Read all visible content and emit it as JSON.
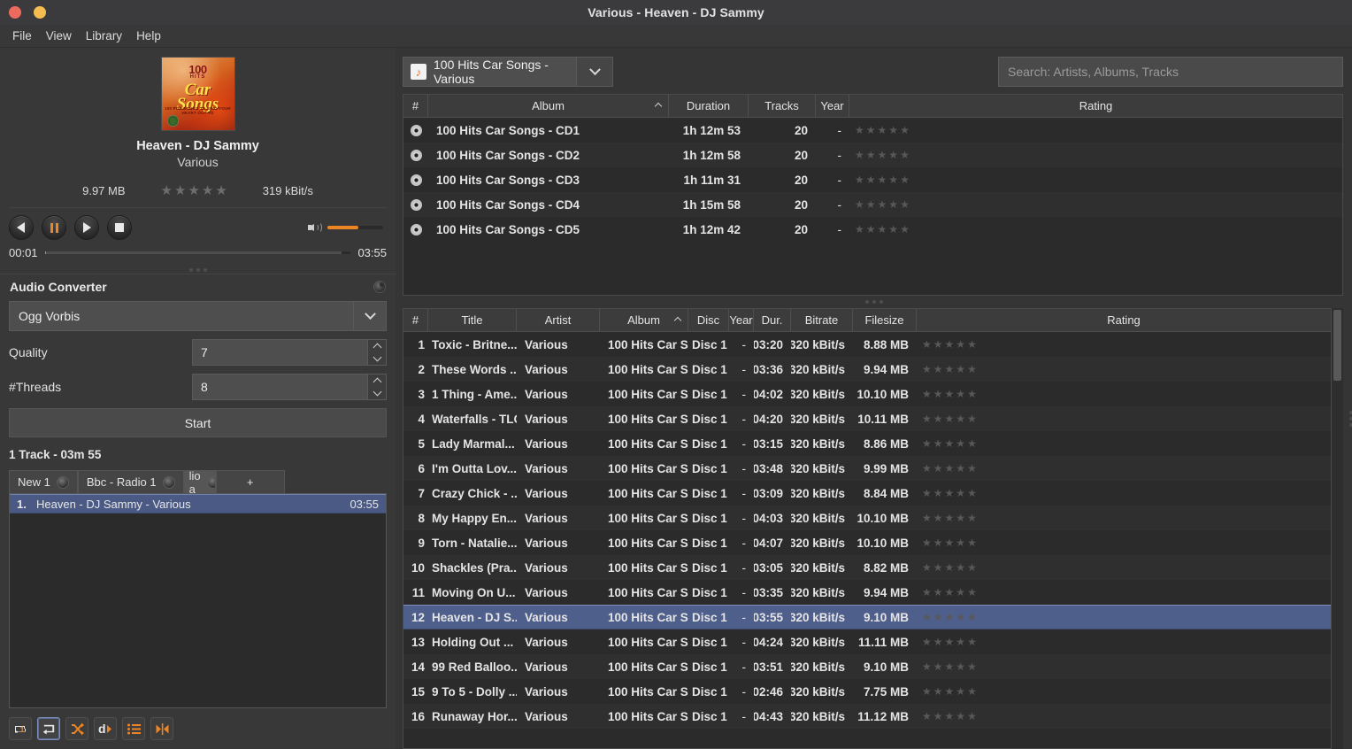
{
  "window": {
    "title": "Various - Heaven - DJ Sammy",
    "buttons": {
      "close": "close",
      "minimize": "minimize"
    }
  },
  "menu": {
    "items": [
      "File",
      "View",
      "Library",
      "Help"
    ]
  },
  "now_playing": {
    "title": "Heaven - DJ Sammy",
    "artist": "Various",
    "filesize": "9.97 MB",
    "bitrate": "319 kBit/s",
    "rating": 0,
    "rating_max": 5,
    "elapsed": "00:01",
    "total": "03:55",
    "progress_percent": 0.45,
    "buffer_percent": 97,
    "volume_percent": 55,
    "cover": {
      "line1": "100",
      "line2": "HITS",
      "line3": "Car",
      "line4": "Songs",
      "tagline": "100 POP SONGS TO SING YOUR HEART OUT TO"
    },
    "controls": {
      "previous": "previous-track",
      "pause": "pause",
      "next": "next-track",
      "stop": "stop"
    }
  },
  "converter": {
    "title": "Audio Converter",
    "format": "Ogg Vorbis",
    "quality_label": "Quality",
    "quality_value": "7",
    "threads_label": "#Threads",
    "threads_value": "8",
    "start_label": "Start",
    "status": "1 Track - 03m 55"
  },
  "playlist": {
    "tabs": [
      {
        "label": "New 1",
        "active": false,
        "partial": false
      },
      {
        "label": "Bbc - Radio 1",
        "active": false,
        "partial": false
      },
      {
        "label": "lio a",
        "active": true,
        "partial": true
      }
    ],
    "add_tab_label": "+",
    "rows": [
      {
        "index": "1.",
        "name": "Heaven - DJ Sammy - Various",
        "duration": "03:55",
        "selected": true
      }
    ],
    "toolbar": [
      {
        "name": "repeat-one-icon",
        "active": false
      },
      {
        "name": "repeat-all-icon",
        "active": true
      },
      {
        "name": "shuffle-icon",
        "active": false
      },
      {
        "name": "dynamic-playlist-icon",
        "active": false
      },
      {
        "name": "queue-list-icon",
        "active": false
      },
      {
        "name": "jump-to-playing-icon",
        "active": false
      }
    ]
  },
  "library": {
    "album_selector": "100 Hits Car Songs - Various",
    "search_placeholder": "Search: Artists, Albums, Tracks",
    "search_value": "",
    "album_table": {
      "columns": [
        "#",
        "Album",
        "Duration",
        "Tracks",
        "Year",
        "Rating"
      ],
      "sorted_column": "Album",
      "sort_direction": "asc",
      "rows": [
        {
          "num": "",
          "album": "100 Hits Car Songs - CD1",
          "duration": "1h 12m 53",
          "tracks": "20",
          "year": "-",
          "rating": 0
        },
        {
          "num": "",
          "album": "100 Hits Car Songs - CD2",
          "duration": "1h 12m 58",
          "tracks": "20",
          "year": "-",
          "rating": 0
        },
        {
          "num": "",
          "album": "100 Hits Car Songs - CD3",
          "duration": "1h 11m 31",
          "tracks": "20",
          "year": "-",
          "rating": 0
        },
        {
          "num": "",
          "album": "100 Hits Car Songs - CD4",
          "duration": "1h 15m 58",
          "tracks": "20",
          "year": "-",
          "rating": 0
        },
        {
          "num": "",
          "album": "100 Hits Car Songs - CD5",
          "duration": "1h 12m 42",
          "tracks": "20",
          "year": "-",
          "rating": 0
        }
      ]
    },
    "track_table": {
      "columns": [
        "#",
        "Title",
        "Artist",
        "Album",
        "Disc",
        "Year",
        "Dur.",
        "Bitrate",
        "Filesize",
        "Rating"
      ],
      "sorted_column": "Album",
      "sort_direction": "asc",
      "rows": [
        {
          "num": "1",
          "title": "Toxic - Britne...",
          "artist": "Various",
          "album": "100 Hits Car S...",
          "disc": "Disc 1",
          "year": "-",
          "dur": "03:20",
          "bitrate": "320 kBit/s",
          "filesize": "8.88 MB",
          "rating": 0,
          "selected": false
        },
        {
          "num": "2",
          "title": "These Words ...",
          "artist": "Various",
          "album": "100 Hits Car S...",
          "disc": "Disc 1",
          "year": "-",
          "dur": "03:36",
          "bitrate": "320 kBit/s",
          "filesize": "9.94 MB",
          "rating": 0,
          "selected": false
        },
        {
          "num": "3",
          "title": "1 Thing - Ame...",
          "artist": "Various",
          "album": "100 Hits Car S...",
          "disc": "Disc 1",
          "year": "-",
          "dur": "04:02",
          "bitrate": "320 kBit/s",
          "filesize": "10.10 MB",
          "rating": 0,
          "selected": false
        },
        {
          "num": "4",
          "title": "Waterfalls - TLC",
          "artist": "Various",
          "album": "100 Hits Car S...",
          "disc": "Disc 1",
          "year": "-",
          "dur": "04:20",
          "bitrate": "320 kBit/s",
          "filesize": "10.11 MB",
          "rating": 0,
          "selected": false
        },
        {
          "num": "5",
          "title": "Lady Marmal...",
          "artist": "Various",
          "album": "100 Hits Car S...",
          "disc": "Disc 1",
          "year": "-",
          "dur": "03:15",
          "bitrate": "320 kBit/s",
          "filesize": "8.86 MB",
          "rating": 0,
          "selected": false
        },
        {
          "num": "6",
          "title": "I'm Outta Lov...",
          "artist": "Various",
          "album": "100 Hits Car S...",
          "disc": "Disc 1",
          "year": "-",
          "dur": "03:48",
          "bitrate": "320 kBit/s",
          "filesize": "9.99 MB",
          "rating": 0,
          "selected": false
        },
        {
          "num": "7",
          "title": "Crazy Chick - ...",
          "artist": "Various",
          "album": "100 Hits Car S...",
          "disc": "Disc 1",
          "year": "-",
          "dur": "03:09",
          "bitrate": "320 kBit/s",
          "filesize": "8.84 MB",
          "rating": 0,
          "selected": false
        },
        {
          "num": "8",
          "title": "My Happy En...",
          "artist": "Various",
          "album": "100 Hits Car S...",
          "disc": "Disc 1",
          "year": "-",
          "dur": "04:03",
          "bitrate": "320 kBit/s",
          "filesize": "10.10 MB",
          "rating": 0,
          "selected": false
        },
        {
          "num": "9",
          "title": "Torn - Natalie...",
          "artist": "Various",
          "album": "100 Hits Car S...",
          "disc": "Disc 1",
          "year": "-",
          "dur": "04:07",
          "bitrate": "320 kBit/s",
          "filesize": "10.10 MB",
          "rating": 0,
          "selected": false
        },
        {
          "num": "10",
          "title": "Shackles (Pra...",
          "artist": "Various",
          "album": "100 Hits Car S...",
          "disc": "Disc 1",
          "year": "-",
          "dur": "03:05",
          "bitrate": "320 kBit/s",
          "filesize": "8.82 MB",
          "rating": 0,
          "selected": false
        },
        {
          "num": "11",
          "title": "Moving On U...",
          "artist": "Various",
          "album": "100 Hits Car S...",
          "disc": "Disc 1",
          "year": "-",
          "dur": "03:35",
          "bitrate": "320 kBit/s",
          "filesize": "9.94 MB",
          "rating": 0,
          "selected": false
        },
        {
          "num": "12",
          "title": "Heaven - DJ S...",
          "artist": "Various",
          "album": "100 Hits Car S...",
          "disc": "Disc 1",
          "year": "-",
          "dur": "03:55",
          "bitrate": "320 kBit/s",
          "filesize": "9.10 MB",
          "rating": 0,
          "selected": true
        },
        {
          "num": "13",
          "title": "Holding Out ...",
          "artist": "Various",
          "album": "100 Hits Car S...",
          "disc": "Disc 1",
          "year": "-",
          "dur": "04:24",
          "bitrate": "320 kBit/s",
          "filesize": "11.11 MB",
          "rating": 0,
          "selected": false
        },
        {
          "num": "14",
          "title": "99 Red Balloo...",
          "artist": "Various",
          "album": "100 Hits Car S...",
          "disc": "Disc 1",
          "year": "-",
          "dur": "03:51",
          "bitrate": "320 kBit/s",
          "filesize": "9.10 MB",
          "rating": 0,
          "selected": false
        },
        {
          "num": "15",
          "title": "9 To 5 - Dolly ...",
          "artist": "Various",
          "album": "100 Hits Car S...",
          "disc": "Disc 1",
          "year": "-",
          "dur": "02:46",
          "bitrate": "320 kBit/s",
          "filesize": "7.75 MB",
          "rating": 0,
          "selected": false
        },
        {
          "num": "16",
          "title": "Runaway Hor...",
          "artist": "Various",
          "album": "100 Hits Car S...",
          "disc": "Disc 1",
          "year": "-",
          "dur": "04:43",
          "bitrate": "320 kBit/s",
          "filesize": "11.12 MB",
          "rating": 0,
          "selected": false
        }
      ]
    }
  },
  "colors": {
    "accent": "#ee8524",
    "selection": "#4f5f8c",
    "window_bg": "#353535",
    "panel_bg": "#383838",
    "table_bg": "#2b2b2b"
  }
}
